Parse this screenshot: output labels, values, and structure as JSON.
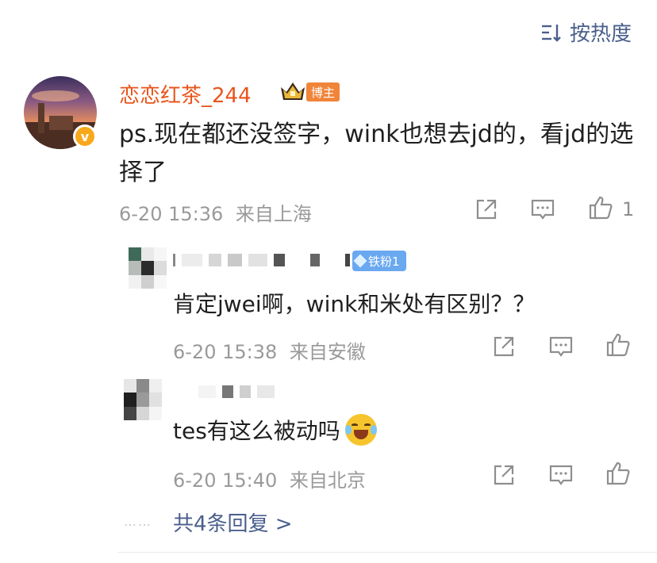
{
  "sort": {
    "label": "按热度"
  },
  "main_comment": {
    "username": "恋恋红茶_244",
    "badge": "博主",
    "verified_mark": "v",
    "text": "ps.现在都还没签字，wink也想去jd的，看jd的选择了",
    "time": "6-20 15:36",
    "location": "来自上海",
    "like_count": "1"
  },
  "replies": [
    {
      "fan_badge": "铁粉1",
      "text": "肯定jwei啊，wink和米处有区别？？",
      "time": "6-20 15:38",
      "location": "来自安徽"
    },
    {
      "text": "tes有这么被动吗",
      "emoji": "laugh-cry-emoji",
      "time": "6-20 15:40",
      "location": "来自北京"
    }
  ],
  "footer": {
    "dots": "……",
    "total_label": "共4条回复 >"
  },
  "colors": {
    "link": "#4a5f8c",
    "username": "#e8551c",
    "meta": "#9a9a9a",
    "fan_badge": "#6aa8f0",
    "bozhu_badge": "#f0853a"
  }
}
